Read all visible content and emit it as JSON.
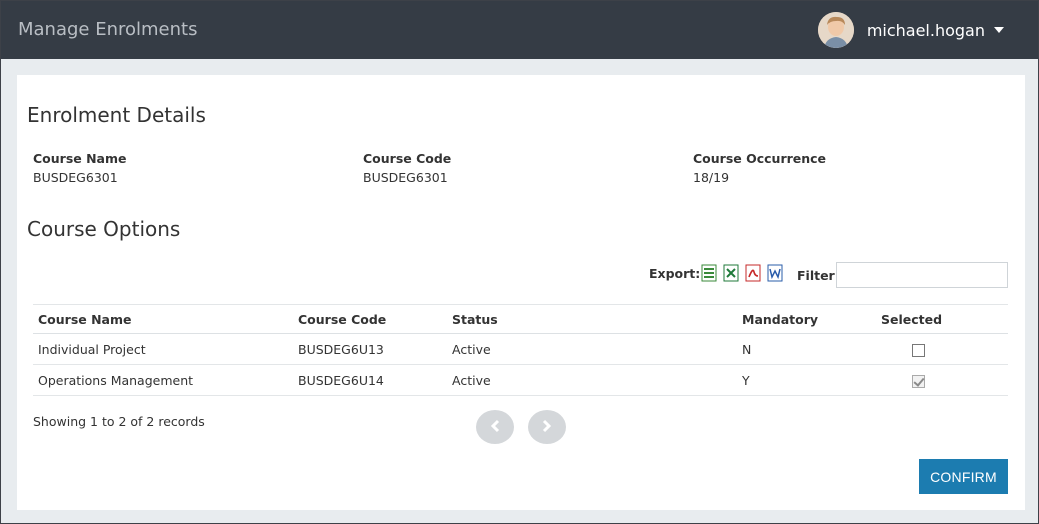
{
  "app": {
    "title": "Manage Enrolments"
  },
  "user": {
    "name": "michael.hogan"
  },
  "enrolment": {
    "heading": "Enrolment Details",
    "fields": [
      {
        "label": "Course Name",
        "value": "BUSDEG6301"
      },
      {
        "label": "Course Code",
        "value": "BUSDEG6301"
      },
      {
        "label": "Course Occurrence",
        "value": "18/19"
      }
    ]
  },
  "options": {
    "heading": "Course Options",
    "export_label": "Export:",
    "export_icons": [
      "csv-icon",
      "excel-icon",
      "pdf-icon",
      "word-icon"
    ],
    "filter_label": "Filter:",
    "filter_value": "",
    "columns": [
      "Course Name",
      "Course Code",
      "Status",
      "Mandatory",
      "Selected"
    ],
    "rows": [
      {
        "name": "Individual Project",
        "code": "BUSDEG6U13",
        "status": "Active",
        "mandatory": "N",
        "selected": false
      },
      {
        "name": "Operations Management",
        "code": "BUSDEG6U14",
        "status": "Active",
        "mandatory": "Y",
        "selected": true
      }
    ],
    "records_text": "Showing 1 to 2 of 2 records"
  },
  "actions": {
    "confirm_label": "CONFIRM"
  },
  "colors": {
    "topbar": "#353c45",
    "accent": "#1c7cb0",
    "background": "#e8ecef"
  }
}
